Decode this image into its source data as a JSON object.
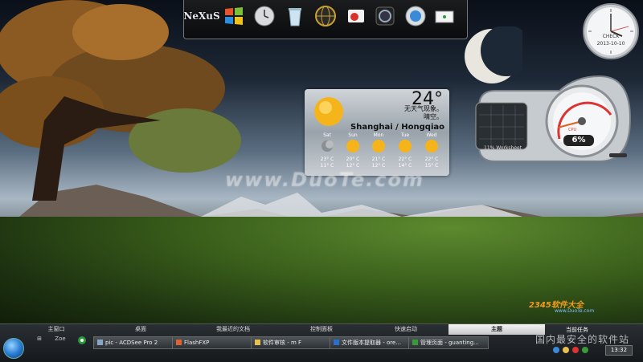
{
  "dock": {
    "items": [
      {
        "name": "nexus-logo",
        "label": "NeXuS"
      },
      {
        "name": "windows-logo-icon"
      },
      {
        "name": "clock-icon"
      },
      {
        "name": "recycle-bin-icon"
      },
      {
        "name": "globe-icon"
      },
      {
        "name": "media-player-icon"
      },
      {
        "name": "camera-icon"
      },
      {
        "name": "web-browser-icon"
      },
      {
        "name": "flag-icon"
      }
    ]
  },
  "clock_gadget": {
    "label": "CHECK",
    "date": "2013-10-10"
  },
  "weather": {
    "temperature": "24°",
    "condition_line1": "无天气现象。",
    "condition_line2": "晴空。",
    "location": "Shanghai / Hongqiao",
    "forecast": [
      {
        "day": "Sat",
        "high": "23° C",
        "low": "11° C",
        "icon": "cloudy-moon-icon"
      },
      {
        "day": "Sun",
        "high": "20° C",
        "low": "12° C",
        "icon": "sun-icon"
      },
      {
        "day": "Mon",
        "high": "21° C",
        "low": "12° C",
        "icon": "sun-icon"
      },
      {
        "day": "Tue",
        "high": "22° C",
        "low": "14° C",
        "icon": "sun-icon"
      },
      {
        "day": "Wed",
        "high": "22° C",
        "low": "15° C",
        "icon": "sun-icon"
      }
    ]
  },
  "cpu_gadget": {
    "cpu_label": "CPU",
    "cpu_percent": "6%",
    "worksheet_label": "11% Worksheet"
  },
  "watermark": "www.DuoTe.com",
  "taskbar": {
    "tabs": [
      {
        "label": "主窗口"
      },
      {
        "label": "桌面"
      },
      {
        "label": "我最近的文档"
      },
      {
        "label": "控制面板"
      },
      {
        "label": "快速启动"
      },
      {
        "label": "主题",
        "active": true
      }
    ],
    "current_tasks_label": "当前任务",
    "quick_launch": [
      {
        "name": "windows-flag-icon",
        "label": "⊞"
      },
      {
        "name": "zoe-icon",
        "label": "Zoe"
      },
      {
        "name": "chrome-icon",
        "label": ""
      }
    ],
    "tasks": [
      {
        "label": "pic - ACDSee Pro 2",
        "color": "#8aa4c8"
      },
      {
        "label": "FlashFXP",
        "color": "#e06030"
      },
      {
        "label": "软件审核 - m F",
        "color": "#e8c050"
      },
      {
        "label": "文件版本提取器 - ore...",
        "color": "#2a6fd0"
      },
      {
        "label": "管理页面 - guanting...",
        "color": "#3a9a3a"
      }
    ],
    "time": "13:32",
    "site_brand": "2345软件大全",
    "site_url": "www.DuoTe.com",
    "site_tagline": "国内最安全的软件站"
  }
}
